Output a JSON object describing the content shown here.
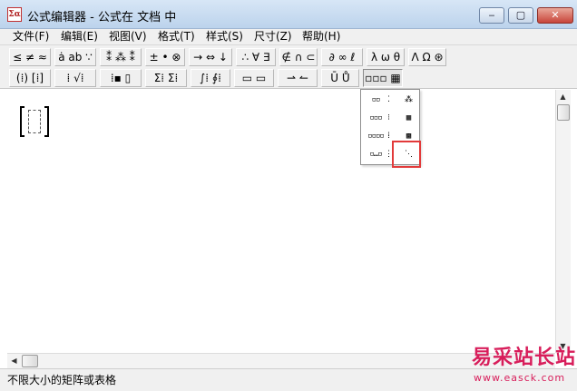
{
  "window": {
    "title": "公式编辑器 - 公式在 文档 中",
    "icon": "formula-app-icon",
    "controls": {
      "minimize": "‒",
      "maximize": "▢",
      "close": "✕"
    }
  },
  "menu": [
    {
      "label": "文件(F)"
    },
    {
      "label": "编辑(E)"
    },
    {
      "label": "视图(V)"
    },
    {
      "label": "格式(T)"
    },
    {
      "label": "样式(S)"
    },
    {
      "label": "尺寸(Z)"
    },
    {
      "label": "帮助(H)"
    }
  ],
  "toolbar": {
    "row1": [
      {
        "icon": "relations-palette-icon",
        "glyph": "≤ ≠ ≈"
      },
      {
        "icon": "spaces-ellipses-palette-icon",
        "glyph": "ȧ ab ∵"
      },
      {
        "icon": "embellishments-palette-icon",
        "glyph": "⁑ ⁂ ⁑"
      },
      {
        "icon": "operators-palette-icon",
        "glyph": "± • ⊗"
      },
      {
        "icon": "arrows-palette-icon",
        "glyph": "→ ⇔ ↓"
      },
      {
        "icon": "logic-palette-icon",
        "glyph": "∴ ∀ ∃"
      },
      {
        "icon": "set-theory-palette-icon",
        "glyph": "∉ ∩ ⊂"
      },
      {
        "icon": "misc-symbols-palette-icon",
        "glyph": "∂ ∞ ℓ"
      },
      {
        "icon": "greek-lower-palette-icon",
        "glyph": "λ ω θ"
      },
      {
        "icon": "greek-upper-palette-icon",
        "glyph": "Λ Ω ⊛"
      }
    ],
    "row2": [
      {
        "icon": "fences-templates-icon",
        "glyph": "(⁞) [⁞]"
      },
      {
        "icon": "fraction-radical-templates-icon",
        "glyph": "⁞ √⁞"
      },
      {
        "icon": "subscript-templates-icon",
        "glyph": "⁞▪ ▯"
      },
      {
        "icon": "summation-templates-icon",
        "glyph": "Σ⁞ Σ⁞"
      },
      {
        "icon": "integral-templates-icon",
        "glyph": "∫⁞ ∮⁞"
      },
      {
        "icon": "underbar-overbar-templates-icon",
        "glyph": "▭ ▭"
      },
      {
        "icon": "labeled-arrow-templates-icon",
        "glyph": "⇀ ↼"
      },
      {
        "icon": "products-templates-icon",
        "glyph": "Ū Ů"
      },
      {
        "icon": "matrix-templates-icon",
        "glyph": "▫▫▫ ▦"
      }
    ]
  },
  "palette": {
    "cells": [
      {
        "icon": "matrix-1x2-icon",
        "glyph": "▫▫"
      },
      {
        "icon": "matrix-2x1-icon",
        "glyph": "⁚"
      },
      {
        "icon": "matrix-2x2-icon",
        "glyph": "⁂"
      },
      {
        "icon": "matrix-1x3-icon",
        "glyph": "▫▫▫"
      },
      {
        "icon": "matrix-3x1-icon",
        "glyph": "⁝"
      },
      {
        "icon": "matrix-3x3-icon",
        "glyph": "▦"
      },
      {
        "icon": "matrix-1x4-icon",
        "glyph": "▫▫▫▫"
      },
      {
        "icon": "matrix-4x1-icon",
        "glyph": "⁞"
      },
      {
        "icon": "matrix-4x4-icon",
        "glyph": "▩"
      },
      {
        "icon": "matrix-1xn-icon",
        "glyph": "▫…▫"
      },
      {
        "icon": "matrix-nx1-icon",
        "glyph": "⋮"
      },
      {
        "icon": "matrix-mxn-icon",
        "glyph": "⋱"
      }
    ],
    "highlighted": "matrix-mxn-icon"
  },
  "document": {
    "content_icon": "matrix-slot-icon"
  },
  "status": {
    "text": "不限大小的矩阵或表格"
  },
  "watermark": {
    "cn": "易采站长站",
    "url": "www.easck.com"
  },
  "colors": {
    "highlight": "#e23a3a",
    "watermark": "#d81e5b"
  }
}
